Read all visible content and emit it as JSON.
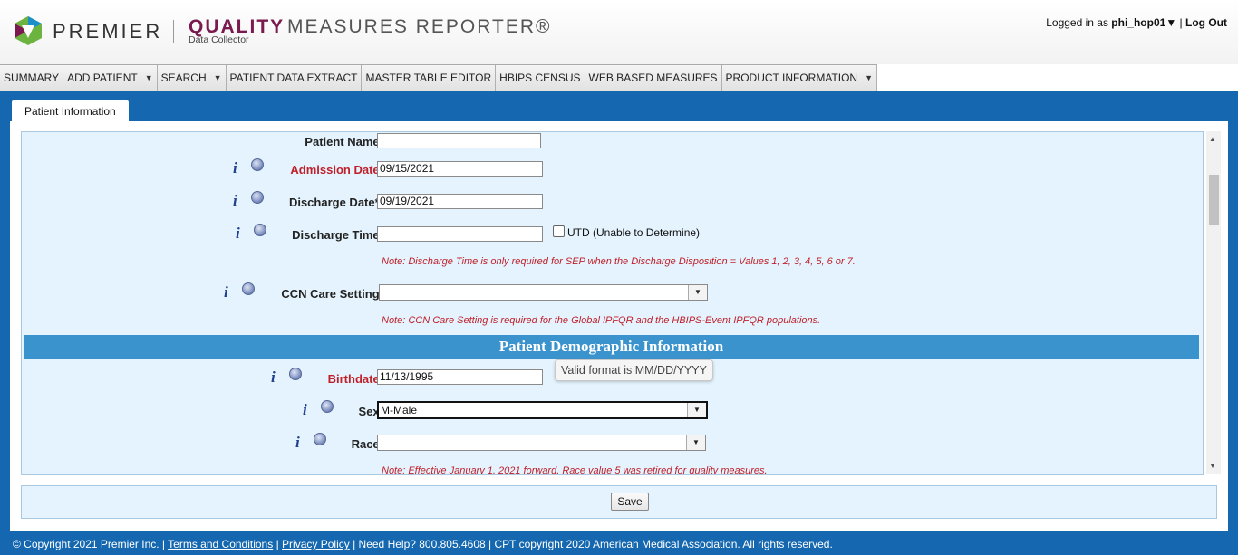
{
  "header": {
    "brand_name": "PREMIER",
    "product_bold": "QUALITY",
    "product_rest": "MEASURES REPORTER®",
    "product_sub": "Data Collector",
    "logged_in_prefix": "Logged in as",
    "username": "phi_hop01",
    "user_caret": "▼",
    "separator": "|",
    "logout": "Log Out"
  },
  "nav": [
    {
      "label": "SUMMARY",
      "dropdown": false
    },
    {
      "label": "ADD PATIENT",
      "dropdown": true
    },
    {
      "label": "SEARCH",
      "dropdown": true
    },
    {
      "label": "PATIENT DATA EXTRACT",
      "dropdown": false
    },
    {
      "label": "MASTER TABLE EDITOR",
      "dropdown": false
    },
    {
      "label": "HBIPS CENSUS",
      "dropdown": false
    },
    {
      "label": "WEB BASED MEASURES",
      "dropdown": false
    },
    {
      "label": "PRODUCT INFORMATION",
      "dropdown": true
    }
  ],
  "tab": {
    "label": "Patient Information"
  },
  "form": {
    "patient_name": {
      "label": "Patient Name:",
      "value": ""
    },
    "admission_date": {
      "label": "Admission Date:",
      "value": "09/15/2021"
    },
    "discharge_date": {
      "label": "Discharge Date*:",
      "value": "09/19/2021"
    },
    "discharge_time": {
      "label": "Discharge Time:",
      "value": "",
      "utd_label": "UTD (Unable to Determine)",
      "utd_checked": false
    },
    "discharge_time_note": "Note: Discharge Time is only required for SEP when the Discharge Disposition = Values 1, 2, 3, 4, 5, 6 or 7.",
    "ccn_care_setting": {
      "label": "CCN Care Setting:",
      "value": ""
    },
    "ccn_note": "Note: CCN Care Setting is required for the Global IPFQR and the HBIPS-Event IPFQR populations.",
    "section_title": "Patient Demographic Information",
    "birthdate": {
      "label": "Birthdate:",
      "value": "11/13/1995"
    },
    "birthdate_tooltip": "Valid format is MM/DD/YYYY",
    "sex": {
      "label": "Sex:",
      "value": "M-Male"
    },
    "race": {
      "label": "Race:",
      "value": ""
    },
    "race_note": "Note: Effective January 1, 2021 forward, Race value 5 was retired for quality measures.",
    "info_glyph": "i"
  },
  "save_label": "Save",
  "footer": {
    "copyright": "© Copyright 2021 Premier Inc.",
    "sep": "|",
    "terms": "Terms and Conditions",
    "privacy": "Privacy Policy",
    "help": "Need Help? 800.805.4608",
    "cpt": "CPT copyright 2020 American Medical Association. All rights reserved."
  },
  "colors": {
    "band": "#1567b0",
    "section": "#3a93cd",
    "required": "#c0202a",
    "brand": "#7a1a4e"
  }
}
